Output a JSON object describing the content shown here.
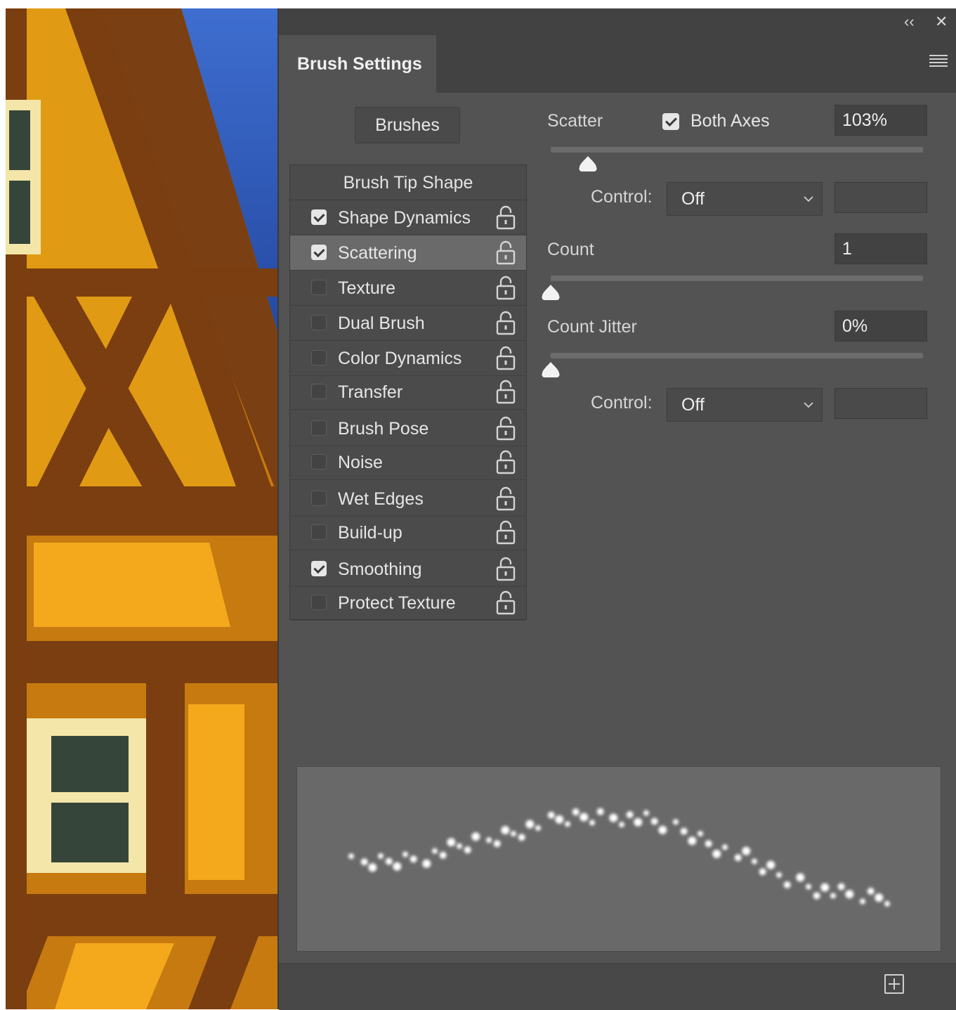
{
  "window": {
    "collapse_icon": "double-chevron-left-icon",
    "close_icon": "close-icon"
  },
  "tab": {
    "title": "Brush Settings"
  },
  "brushes_button": "Brushes",
  "brush_tip_shape": "Brush Tip Shape",
  "options": [
    {
      "label": "Shape Dynamics",
      "checked": true
    },
    {
      "label": "Scattering",
      "checked": true,
      "selected": true
    },
    {
      "label": "Texture",
      "checked": false
    },
    {
      "label": "Dual Brush",
      "checked": false
    },
    {
      "label": "Color Dynamics",
      "checked": false
    },
    {
      "label": "Transfer",
      "checked": false
    },
    {
      "label": "Brush Pose",
      "checked": false
    },
    {
      "label": "Noise",
      "checked": false
    },
    {
      "label": "Wet Edges",
      "checked": false
    },
    {
      "label": "Build-up",
      "checked": false
    },
    {
      "label": "Smoothing",
      "checked": true
    },
    {
      "label": "Protect Texture",
      "checked": false
    }
  ],
  "scattering": {
    "scatter_label": "Scatter",
    "both_axes_label": "Both Axes",
    "both_axes_checked": true,
    "scatter_value": "103%",
    "scatter_slider_fraction": 0.1,
    "control_label": "Control:",
    "control_value": "Off",
    "count_label": "Count",
    "count_value": "1",
    "count_slider_fraction": 0.0,
    "count_jitter_label": "Count Jitter",
    "count_jitter_value": "0%",
    "count_jitter_slider_fraction": 0.0,
    "control2_label": "Control:",
    "control2_value": "Off"
  },
  "footer": {
    "new_preset_icon": "new-preset-icon"
  }
}
